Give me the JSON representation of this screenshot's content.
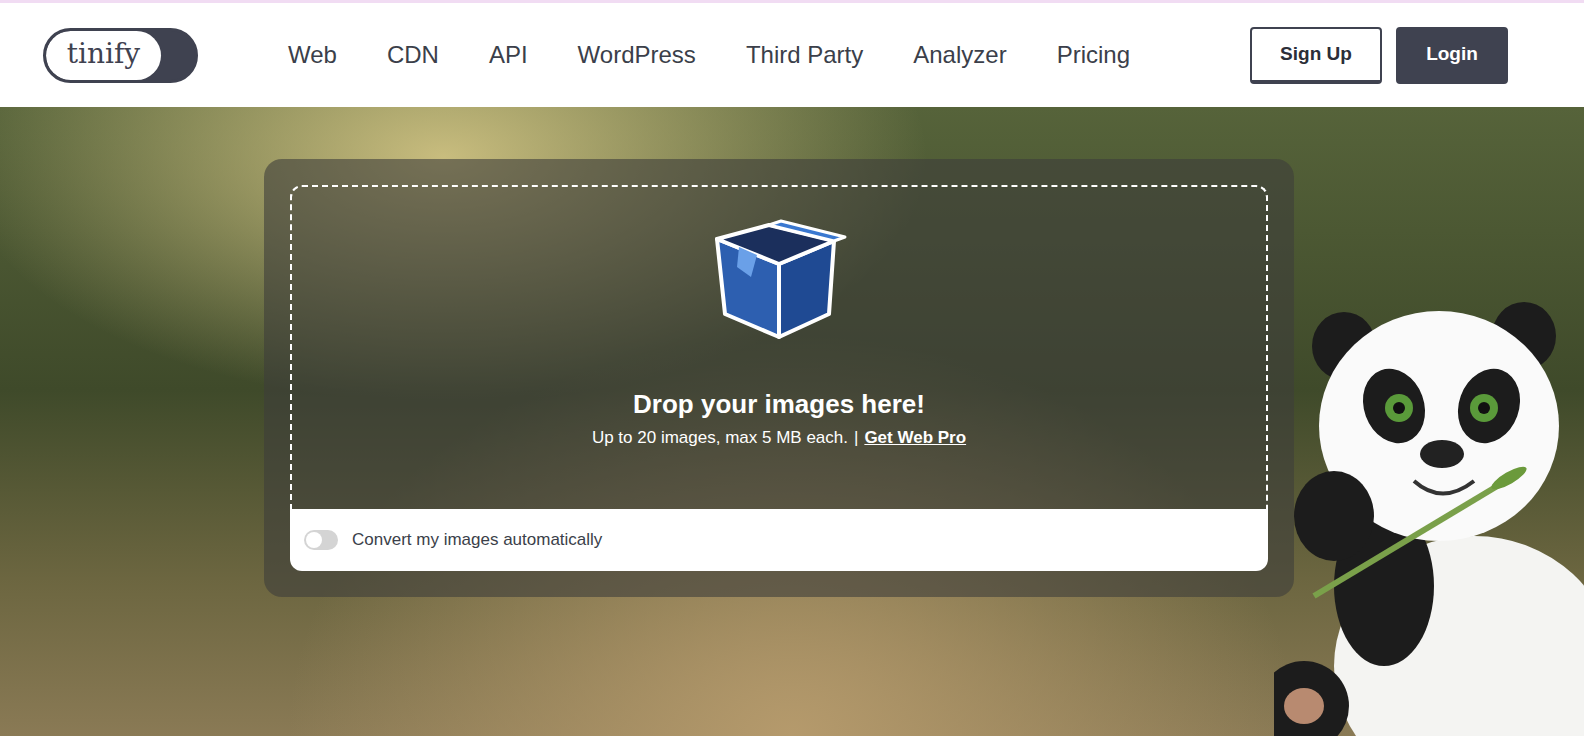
{
  "logo": {
    "text": "tinify"
  },
  "nav": [
    {
      "label": "Web"
    },
    {
      "label": "CDN"
    },
    {
      "label": "API"
    },
    {
      "label": "WordPress"
    },
    {
      "label": "Third Party"
    },
    {
      "label": "Analyzer"
    },
    {
      "label": "Pricing"
    }
  ],
  "auth": {
    "signup": "Sign Up",
    "login": "Login"
  },
  "dropzone": {
    "title": "Drop your images here!",
    "limits": "Up to 20 images, max 5 MB each.",
    "separator": "|",
    "link": "Get Web Pro"
  },
  "convert": {
    "label": "Convert my images automatically",
    "on": false
  }
}
